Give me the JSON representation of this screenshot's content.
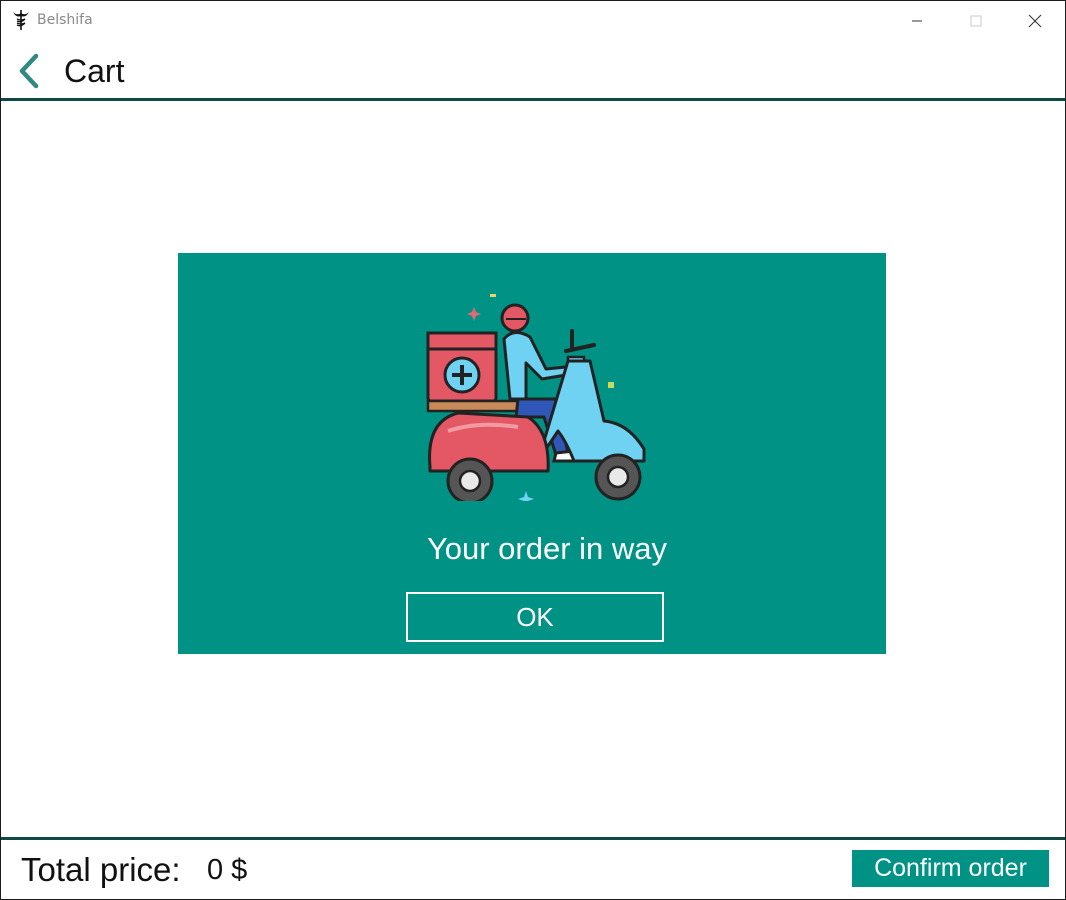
{
  "window": {
    "title": "Belshifa",
    "app_icon": "caduceus-icon",
    "controls": [
      "minimize-icon",
      "maximize-icon",
      "close-icon"
    ]
  },
  "header": {
    "back_icon": "chevron-left-icon",
    "title": "Cart"
  },
  "dialog": {
    "illustration": "delivery-scooter-icon",
    "message": "Your order in way",
    "ok_label": "OK"
  },
  "footer": {
    "total_label": "Total price:",
    "total_value": "0 $",
    "confirm_label": "Confirm order"
  },
  "colors": {
    "accent": "#009385",
    "rule": "#0e4a45",
    "text": "#111111"
  }
}
